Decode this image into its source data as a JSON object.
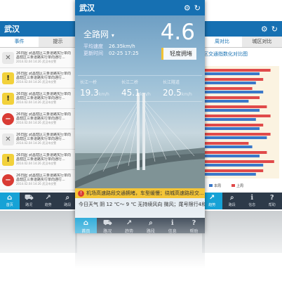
{
  "left": {
    "title": "武汉",
    "tabs": [
      "事件",
      "提示"
    ],
    "events": [
      {
        "icon": "tools",
        "l1": "26日起 武昌辖区三条道路实行单向",
        "l2": "昌辖区三条道路实行单向通行...",
        "d": "2014.02.04 14:26",
        "s": "武汉市交警"
      },
      {
        "icon": "warning",
        "l1": "26日起 武昌辖区三条道路实行单向",
        "l2": "昌辖区三条道路实行单向通行...",
        "d": "2014.02.04 14:26",
        "s": "武汉市交警"
      },
      {
        "icon": "warning",
        "l1": "26日起 武昌辖区三条道路实行单向",
        "l2": "昌辖区三条道路实行单向通行...",
        "d": "2014.02.04 14:26",
        "s": "武汉市交警"
      },
      {
        "icon": "noentry",
        "l1": "26日起 武昌辖区三条道路实行单向",
        "l2": "昌辖区三条道路实行单向通行...",
        "d": "2014.02.04 14:26",
        "s": "武汉市交警"
      },
      {
        "icon": "tools",
        "l1": "26日起 武昌辖区三条道路实行单向",
        "l2": "昌辖区三条道路实行单向通行...",
        "d": "2014.02.04 14:26",
        "s": "武汉市交警"
      },
      {
        "icon": "warning",
        "l1": "26日起 武昌辖区三条道路实行单向",
        "l2": "昌辖区三条道路实行单向通行...",
        "d": "2014.02.04 14:26",
        "s": "武汉市交警"
      },
      {
        "icon": "noentry",
        "l1": "26日起 武昌辖区三条道路实行单向",
        "l2": "昌辖区三条道路实行单向通行...",
        "d": "2014.02.04 14:26",
        "s": "武汉市交警"
      },
      {
        "icon": "warning",
        "l1": "26日起 武昌辖区三条道路实行单向",
        "l2": "昌辖区三条道路实行单向通行...",
        "d": "2014.02.04 14:26",
        "s": "武汉市交警"
      }
    ],
    "nav": [
      "首页",
      "路况",
      "趋势",
      "路段"
    ]
  },
  "center": {
    "title": "武汉",
    "network": "全路网",
    "avg_speed_label": "平均速度",
    "avg_speed": "26.35km/h",
    "update_label": "更新时间",
    "update_time": "02-25 17:25",
    "index": "4.6",
    "congestion": "轻度拥堵",
    "roads": [
      {
        "name": "长江一桥",
        "speed": "19.3",
        "unit": "km/h"
      },
      {
        "name": "长江二桥",
        "speed": "45.1",
        "unit": "km/h"
      },
      {
        "name": "长江隧道",
        "speed": "20.5",
        "unit": "km/h"
      }
    ],
    "alert": "机场高速路段交通拥堵，车型缓慢；绕城高速路段交...",
    "weather": "今日天气  阴  12 ℃～ 9 ℃  无持续风向 微风；尾号限行4和7",
    "nav": [
      "首页",
      "路况",
      "趋势",
      "路段",
      "信息",
      "帮助"
    ]
  },
  "right": {
    "tabs": [
      "周对比",
      "城区对比"
    ],
    "heading": "区交通指数化对比图",
    "legend": [
      "本周",
      "上周"
    ],
    "nav": [
      "趋势",
      "路段",
      "信息",
      "帮助"
    ],
    "colors": {
      "this_week": "#e04a4a",
      "last_week": "#3b78c9"
    }
  },
  "chart_data": {
    "type": "bar",
    "title": "区交通指数化对比图",
    "series": [
      {
        "name": "本周",
        "values": [
          3.6,
          3.2,
          2.6,
          3.0,
          3.4,
          3.6,
          3.2,
          3.6,
          2.4,
          3.4,
          3.8,
          3.2
        ]
      },
      {
        "name": "上周",
        "values": [
          3.0,
          2.8,
          3.2,
          2.4,
          3.0,
          2.8,
          3.0,
          3.4,
          2.6,
          3.0,
          3.2,
          2.8
        ]
      }
    ]
  }
}
